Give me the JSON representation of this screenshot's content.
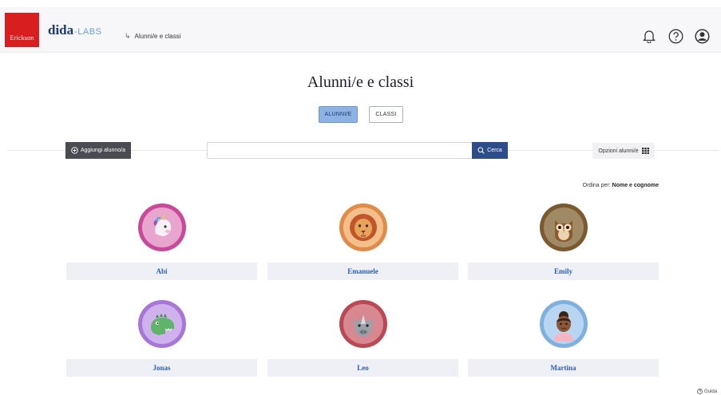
{
  "header": {
    "logo_text": "Erickson",
    "brand_main": "dida",
    "brand_sub": "-LABS",
    "breadcrumb": "Alunni/e e classi",
    "icons": [
      "bell-icon",
      "help-icon",
      "user-account-icon"
    ]
  },
  "page": {
    "title": "Alunni/e e classi",
    "tabs": [
      {
        "label": "ALUNNI/E",
        "active": true
      },
      {
        "label": "CLASSI",
        "active": false
      }
    ]
  },
  "toolbar": {
    "add_label": "Aggiungi alunno/a",
    "search_value": "",
    "search_placeholder": "",
    "search_button": "Cerca",
    "options_label": "Opzioni alunni/e"
  },
  "sort": {
    "label": "Ordina per:",
    "value": "Nome e cognome"
  },
  "students": [
    {
      "name": "Abi",
      "avatar": "unicorn",
      "ring": "#c94a9a",
      "bg": "#e8a6cf"
    },
    {
      "name": "Emanuele",
      "avatar": "lion",
      "ring": "#e08b4a",
      "bg": "#f3c08c"
    },
    {
      "name": "Emily",
      "avatar": "owl",
      "ring": "#7a5a2e",
      "bg": "#a08a66"
    },
    {
      "name": "Jonas",
      "avatar": "dinosaur",
      "ring": "#a777d8",
      "bg": "#cfb1ec"
    },
    {
      "name": "Leo",
      "avatar": "rhino",
      "ring": "#b94a55",
      "bg": "#d78891"
    },
    {
      "name": "Martina",
      "avatar": "girl",
      "ring": "#7fb0de",
      "bg": "#b8d6f1"
    }
  ],
  "footer": {
    "guide_label": "Guida"
  }
}
